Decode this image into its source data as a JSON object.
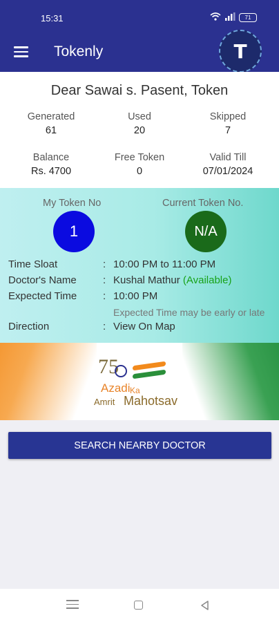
{
  "status_bar": {
    "time": "15:31",
    "battery": "71"
  },
  "app": {
    "title": "Tokenly",
    "logo_letter": "T"
  },
  "summary": {
    "greeting": "Dear Sawai s. Pasent, Token",
    "generated_label": "Generated",
    "generated_value": "61",
    "used_label": "Used",
    "used_value": "20",
    "skipped_label": "Skipped",
    "skipped_value": "7",
    "balance_label": "Balance",
    "balance_value": "Rs. 4700",
    "free_label": "Free Token",
    "free_value": "0",
    "valid_label": "Valid Till",
    "valid_value": "07/01/2024"
  },
  "token": {
    "my_label": "My Token No",
    "my_value": "1",
    "current_label": "Current Token No.",
    "current_value": "N/A",
    "time_slot_label": "Time Sloat",
    "time_slot_value": "10:00 PM to 11:00 PM",
    "doctor_label": "Doctor's Name",
    "doctor_value": "Kushal Mathur",
    "doctor_status": "(Available)",
    "expected_label": "Expected Time",
    "expected_value": "10:00 PM",
    "expected_note": "Expected Time may be early or late",
    "direction_label": "Direction",
    "direction_value": "View On Map",
    "colon": ":"
  },
  "banner": {
    "number": "75",
    "line1": "Azadi",
    "line2": "Ka",
    "line3": "Amrit",
    "line4": "Mahotsav"
  },
  "actions": {
    "search_button": "SEARCH NEARBY DOCTOR"
  },
  "colors": {
    "primary": "#2b3190",
    "available": "#18a218",
    "my_token": "#0b0be0",
    "current_token": "#1a6a1a"
  }
}
